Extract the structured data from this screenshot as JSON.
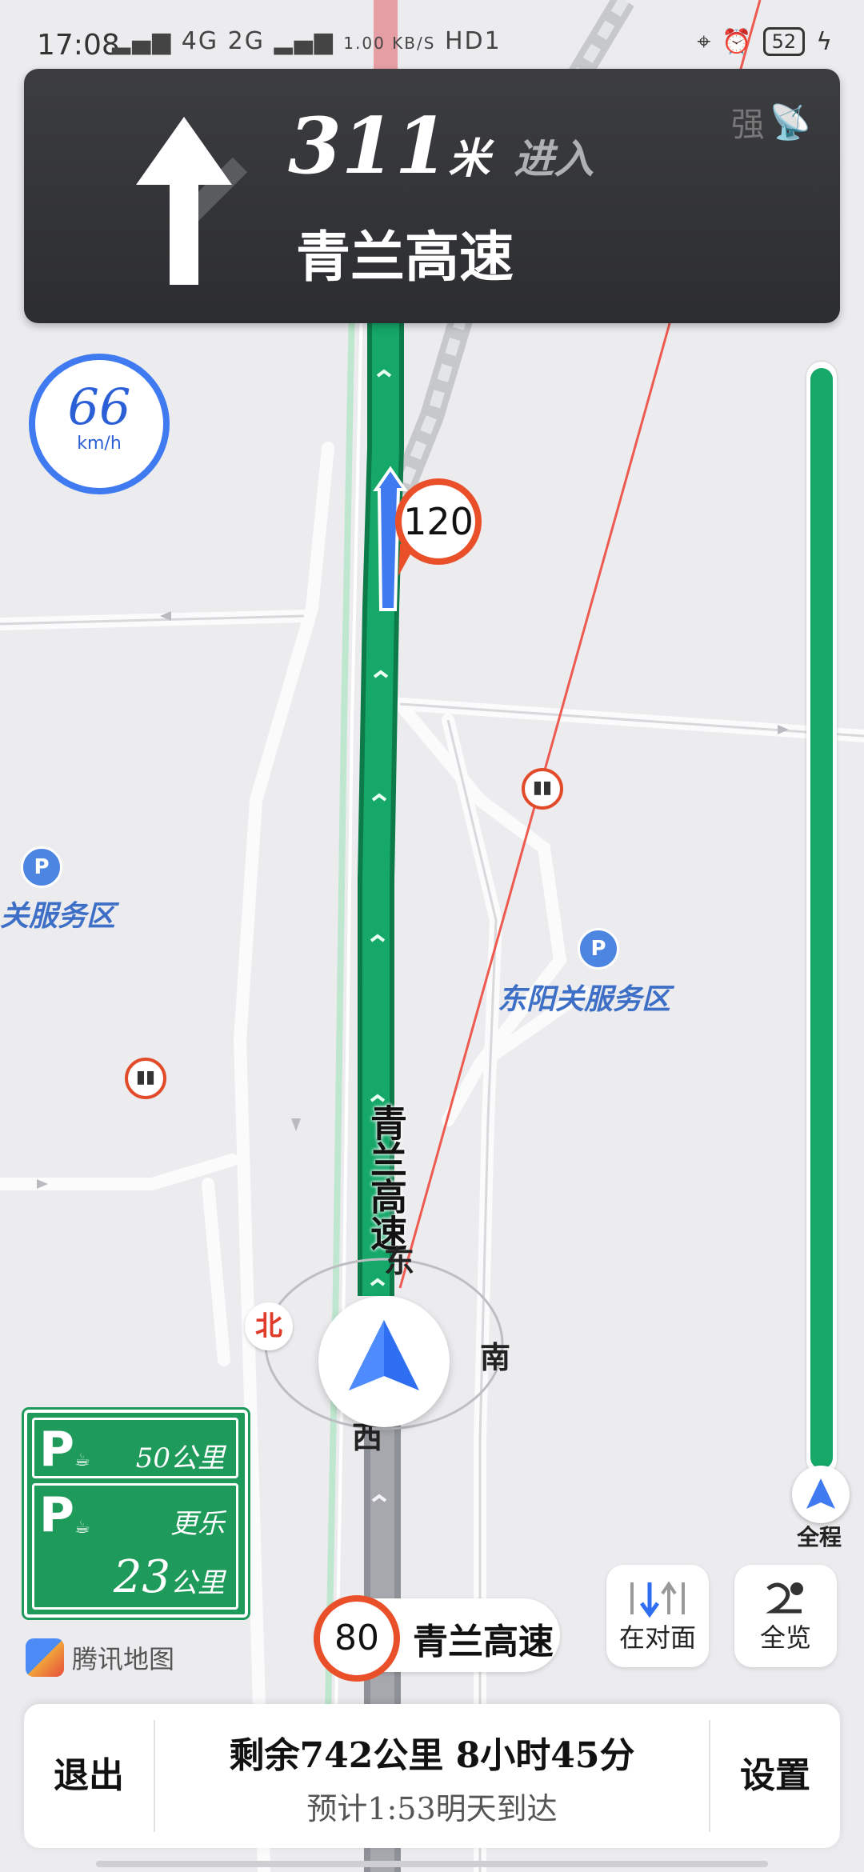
{
  "status_bar": {
    "time": "17:08",
    "network": "4G 2G",
    "speed": "1.00 KB/S",
    "hd": "HD1",
    "battery": "52"
  },
  "banner": {
    "distance": "311",
    "unit": "米",
    "action": "进入",
    "road": "青兰高速",
    "signal": "强"
  },
  "current_speed": {
    "value": "66",
    "unit": "km/h"
  },
  "speed_limit_bubble": "120",
  "map_labels": {
    "poi_left": "关服务区",
    "poi_right": "东阳关服务区",
    "poi_icon": "P",
    "road_vertical": "青兰高速"
  },
  "compass": {
    "north": "北",
    "east": "东",
    "south": "南",
    "west": "西"
  },
  "route_progress": {
    "label": "全程",
    "fraction": 1.0
  },
  "service_signs": [
    {
      "name": "",
      "distance": "50",
      "unit": "公里"
    },
    {
      "name": "更乐",
      "distance": "23",
      "unit": "公里"
    }
  ],
  "buttons": {
    "opposite": "在对面",
    "overview": "全览"
  },
  "bottom_road": {
    "limit": "80",
    "name": "青兰高速"
  },
  "brand": "腾讯地图",
  "footer": {
    "exit": "退出",
    "remaining": "剩余742公里 8小时45分",
    "eta": "预计1:53明天到达",
    "settings": "设置"
  },
  "colors": {
    "route_green": "#15a869",
    "banner_bg": "#333437",
    "accent_blue": "#3f7af0",
    "limit_red": "#e9502a"
  }
}
